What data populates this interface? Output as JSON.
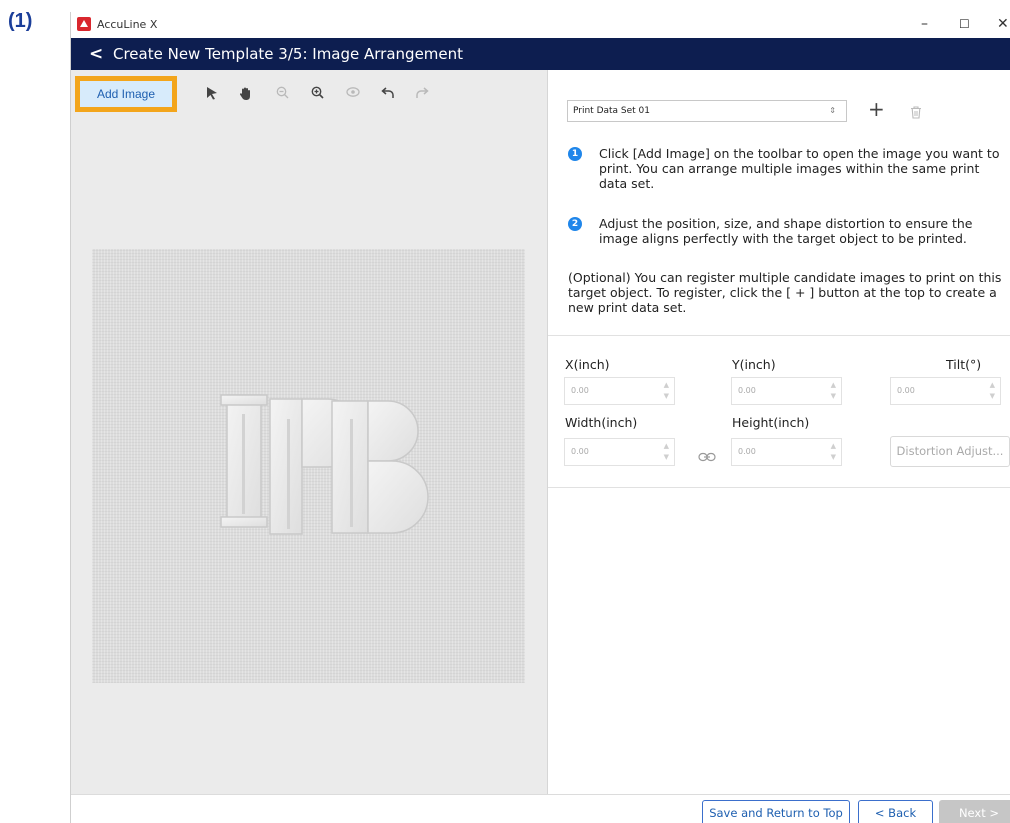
{
  "figure_label": "(1)",
  "window": {
    "app_title": "AccuLine X",
    "controls": [
      "–",
      "☐",
      "✕"
    ]
  },
  "header": {
    "back_icon": "chevron-left-icon",
    "title": "Create New Template 3/5: Image Arrangement"
  },
  "toolbar": {
    "add_image_label": "Add Image",
    "tools": [
      {
        "name": "select-arrow-icon",
        "glyph": "➤",
        "enabled": true
      },
      {
        "name": "hand-pan-icon",
        "glyph": "✋",
        "enabled": true
      },
      {
        "name": "zoom-out-icon",
        "glyph": "⊖",
        "enabled": false
      },
      {
        "name": "zoom-in-icon",
        "glyph": "⊕",
        "enabled": true
      },
      {
        "name": "preview-eye-icon",
        "glyph": "◉",
        "enabled": false
      },
      {
        "name": "undo-icon",
        "glyph": "↶",
        "enabled": true
      },
      {
        "name": "redo-icon",
        "glyph": "↷",
        "enabled": false
      }
    ]
  },
  "right": {
    "dataset_select_value": "Print Data Set 01",
    "steps": [
      {
        "num": "1",
        "text": "Click [Add Image] on the toolbar to open the image you want to print. You can arrange multiple images within the same print data set."
      },
      {
        "num": "2",
        "text": "Adjust the position, size, and shape distortion to ensure the image aligns perfectly with the target object to be printed."
      }
    ],
    "optional_text": "(Optional) You can register multiple candidate images to print on this target object. To register, click the [ + ] button at the top to create a new print data set.",
    "fields": {
      "x_label": "X(inch)",
      "x_value": "0.00",
      "y_label": "Y(inch)",
      "y_value": "0.00",
      "tilt_label": "Tilt(°)",
      "tilt_value": "0.00",
      "width_label": "Width(inch)",
      "width_value": "0.00",
      "height_label": "Height(inch)",
      "height_value": "0.00"
    },
    "distortion_button": "Distortion Adjust..."
  },
  "footer": {
    "save_label": "Save and Return to Top",
    "back_label": "< Back",
    "next_label": "Next >"
  },
  "colors": {
    "header_bg": "#0d1e50",
    "highlight": "#f3a51b",
    "accent": "#1f86ea"
  }
}
